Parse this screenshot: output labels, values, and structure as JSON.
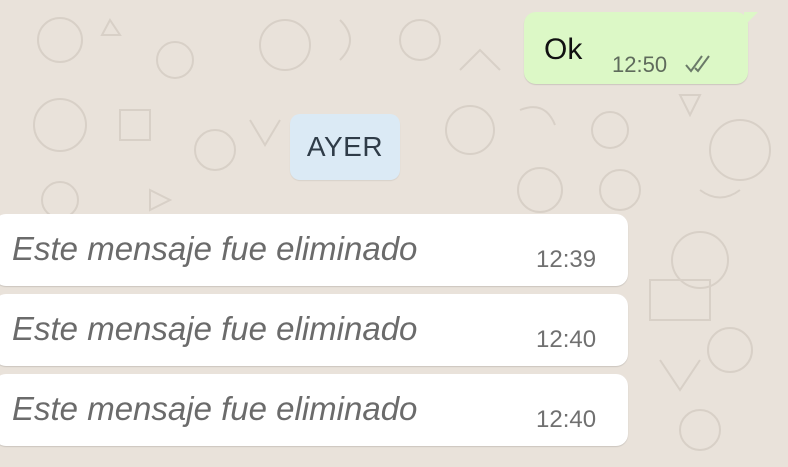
{
  "chat": {
    "sent_message": {
      "text": "Ok",
      "time": "12:50",
      "status_icon": "double-check-icon"
    },
    "date_separator": "AYER",
    "received_messages": [
      {
        "text": "Este mensaje fue eliminado",
        "time": "12:39"
      },
      {
        "text": "Este mensaje fue eliminado",
        "time": "12:40"
      },
      {
        "text": "Este mensaje fue eliminado",
        "time": "12:40"
      }
    ]
  },
  "colors": {
    "background": "#e9e2da",
    "outgoing_bubble": "#dcf8c6",
    "incoming_bubble": "#ffffff",
    "date_chip": "#dbeaf5"
  }
}
